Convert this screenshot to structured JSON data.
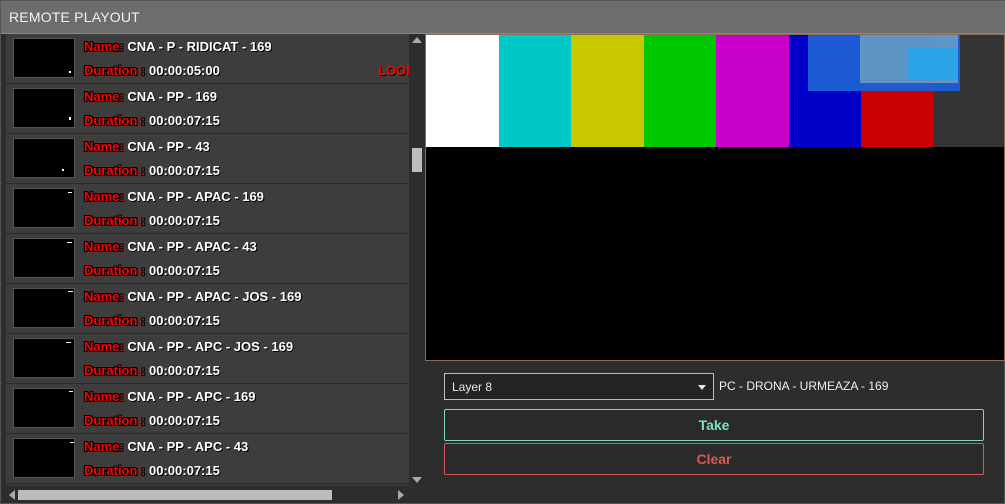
{
  "window": {
    "title": "REMOTE PLAYOUT"
  },
  "playlist": {
    "name_label": "Name:",
    "duration_label": "Duration :",
    "items": [
      {
        "name": "CNA - P - RIDICAT - 169",
        "duration": "00:00:05:00",
        "flag": "LOOP"
      },
      {
        "name": "CNA - PP - 169",
        "duration": "00:00:07:15",
        "flag": ""
      },
      {
        "name": "CNA - PP - 43",
        "duration": "00:00:07:15",
        "flag": ""
      },
      {
        "name": "CNA - PP - APAC - 169",
        "duration": "00:00:07:15",
        "flag": ""
      },
      {
        "name": "CNA - PP - APAC - 43",
        "duration": "00:00:07:15",
        "flag": ""
      },
      {
        "name": "CNA - PP - APAC - JOS - 169",
        "duration": "00:00:07:15",
        "flag": ""
      },
      {
        "name": "CNA - PP - APC -  JOS - 169",
        "duration": "00:00:07:15",
        "flag": ""
      },
      {
        "name": "CNA - PP - APC - 169",
        "duration": "00:00:07:15",
        "flag": ""
      },
      {
        "name": "CNA - PP - APC - 43",
        "duration": "00:00:07:15",
        "flag": ""
      }
    ]
  },
  "preview": {
    "color_bars": [
      "#ffffff",
      "#00c8c8",
      "#c8c800",
      "#00c800",
      "#c800c8",
      "#0000c8",
      "#c80000",
      "#333333"
    ]
  },
  "controls": {
    "layer_value": "Layer 8",
    "current_item": "PC - DRONA - URMEAZA - 169",
    "take_label": "Take",
    "clear_label": "Clear"
  },
  "colors": {
    "label_red": "#ff0000",
    "take_accent": "#7fe0bf",
    "clear_accent": "#d65a5a"
  }
}
